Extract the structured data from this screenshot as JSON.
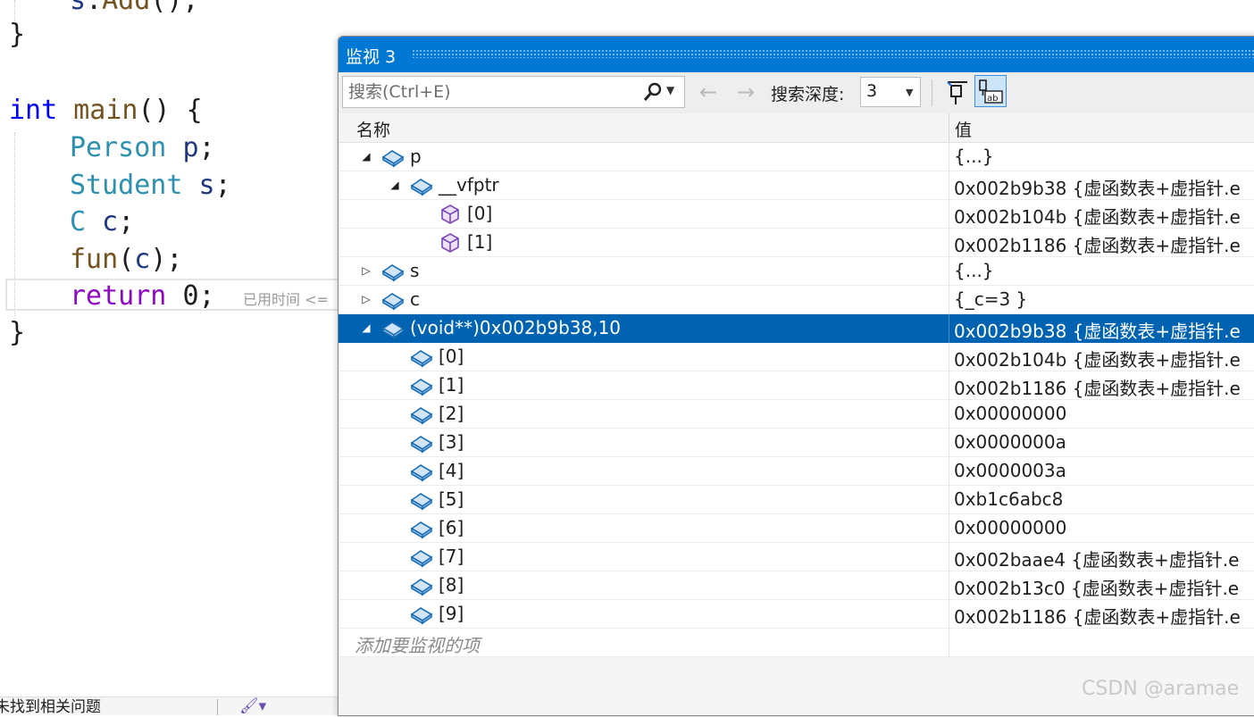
{
  "editor": {
    "line_top": {
      "kw1": "s",
      "dot": ".",
      "fn": "Add",
      "rest": "();"
    },
    "close1": "}",
    "main_sig": {
      "type": "int",
      "name": "main",
      "rest": "() {"
    },
    "l_person": {
      "type": "Person",
      "var": "p",
      "semi": ";"
    },
    "l_student": {
      "type": "Student",
      "var": "s",
      "semi": ";"
    },
    "l_c": {
      "type": "C",
      "var": "c",
      "semi": ";"
    },
    "l_fun": {
      "fn": "fun",
      "open": "(",
      "arg": "c",
      "close": ");"
    },
    "l_return": {
      "kw": "return",
      "num": "0",
      "semi": ";"
    },
    "perf_hint": "已用时间 <=",
    "close2": "}"
  },
  "status_bar": {
    "text": "未找到相关问题"
  },
  "watch": {
    "title": "监视 3",
    "search_placeholder": "搜索(Ctrl+E)",
    "depth_label": "搜索深度:",
    "depth_value": "3",
    "col_name": "名称",
    "col_value": "值",
    "rows": [
      {
        "name": "p",
        "value": "{...}",
        "level": 0,
        "expander": "expanded",
        "icon": "object-icon"
      },
      {
        "name": "__vfptr",
        "value": "0x002b9b38 {虚函数表+虚指针.e",
        "level": 1,
        "expander": "expanded",
        "icon": "object-icon"
      },
      {
        "name": "[0]",
        "value": "0x002b104b {虚函数表+虚指针.e",
        "level": 2,
        "expander": "none",
        "icon": "method-icon"
      },
      {
        "name": "[1]",
        "value": "0x002b1186 {虚函数表+虚指针.e",
        "level": 2,
        "expander": "none",
        "icon": "method-icon"
      },
      {
        "name": "s",
        "value": "{...}",
        "level": 0,
        "expander": "collapsed",
        "icon": "object-icon"
      },
      {
        "name": "c",
        "value": "{_c=3 }",
        "level": 0,
        "expander": "collapsed",
        "icon": "object-icon"
      },
      {
        "name": "(void**)0x002b9b38,10",
        "value": "0x002b9b38 {虚函数表+虚指针.e",
        "level": 0,
        "expander": "expanded",
        "icon": "object-icon",
        "selected": true
      },
      {
        "name": "[0]",
        "value": "0x002b104b {虚函数表+虚指针.e",
        "level": 1,
        "expander": "none",
        "icon": "object-icon"
      },
      {
        "name": "[1]",
        "value": "0x002b1186 {虚函数表+虚指针.e",
        "level": 1,
        "expander": "none",
        "icon": "object-icon"
      },
      {
        "name": "[2]",
        "value": "0x00000000",
        "level": 1,
        "expander": "none",
        "icon": "object-icon"
      },
      {
        "name": "[3]",
        "value": "0x0000000a",
        "level": 1,
        "expander": "none",
        "icon": "object-icon"
      },
      {
        "name": "[4]",
        "value": "0x0000003a",
        "level": 1,
        "expander": "none",
        "icon": "object-icon"
      },
      {
        "name": "[5]",
        "value": "0xb1c6abc8",
        "level": 1,
        "expander": "none",
        "icon": "object-icon"
      },
      {
        "name": "[6]",
        "value": "0x00000000",
        "level": 1,
        "expander": "none",
        "icon": "object-icon"
      },
      {
        "name": "[7]",
        "value": "0x002baae4 {虚函数表+虚指针.e",
        "level": 1,
        "expander": "none",
        "icon": "object-icon"
      },
      {
        "name": "[8]",
        "value": "0x002b13c0 {虚函数表+虚指针.e",
        "level": 1,
        "expander": "none",
        "icon": "object-icon"
      },
      {
        "name": "[9]",
        "value": "0x002b1186 {虚函数表+虚指针.e",
        "level": 1,
        "expander": "none",
        "icon": "object-icon"
      }
    ],
    "add_item_placeholder": "添加要监视的项"
  },
  "watermark": "CSDN @aramae",
  "colors": {
    "accent": "#0078d4",
    "selection": "#0063b1",
    "keyword": "#0000ff",
    "control_keyword": "#8f08c4",
    "type": "#2b91af"
  }
}
